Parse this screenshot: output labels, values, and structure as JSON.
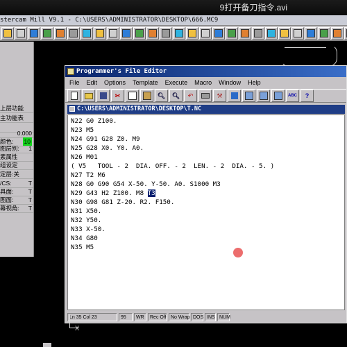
{
  "video": {
    "title": "9打开备刀指令.avi"
  },
  "mastercam": {
    "title": "stercam Mill V9.1 - C:\\USERS\\ADMINISTRATOR\\DESKTOP\\666.MC9",
    "toolbar_icons": [
      "prev-icon",
      "next-icon",
      "zoom-in-icon",
      "zoom-out-icon",
      "zoom-window-icon",
      "pan-icon",
      "fit-icon",
      "view-top-icon",
      "view-front-icon",
      "view-side-icon",
      "view-iso-icon",
      "cube-icon",
      "cube-top-icon",
      "cube-front-icon",
      "cube-side-icon",
      "cube-iso-icon",
      "cube-back-icon",
      "cube-bottom-icon",
      "cube-right-icon",
      "cube-left-icon",
      "cube-view-icon",
      "measure-icon",
      "palette-icon",
      "clipboard-icon",
      "settings-icon",
      "shade-icon",
      "help-icon",
      "globe-icon",
      "sum-icon",
      "chip-icon"
    ],
    "left_menu": [
      {
        "label": "上层功能",
        "value": ""
      },
      {
        "label": "主功能表",
        "value": ""
      },
      {
        "label": "",
        "value": ""
      },
      {
        "label": "",
        "value": "0.000"
      },
      {
        "label": "颜色:",
        "value": "10"
      },
      {
        "label": "图层别:",
        "value": "1"
      },
      {
        "label": "素属性",
        "value": ""
      },
      {
        "label": "组设定",
        "value": ""
      },
      {
        "label": "定层:关",
        "value": ""
      },
      {
        "label": "/CS:",
        "value": "T"
      },
      {
        "label": "具面:",
        "value": "T"
      },
      {
        "label": "图面:",
        "value": "T"
      },
      {
        "label": "幕视角:",
        "value": "T"
      }
    ],
    "axis_label": "X"
  },
  "pfe": {
    "title": "Programmer's File Editor",
    "menu": [
      "File",
      "Edit",
      "Options",
      "Template",
      "Execute",
      "Macro",
      "Window",
      "Help"
    ],
    "doc_title": "C:\\USERS\\ADMINISTRATOR\\DESKTOP\\T.NC",
    "lines": [
      "N22 G0 Z100.",
      "N23 M5",
      "N24 G91 G28 Z0. M9",
      "N25 G28 X0. Y0. A0.",
      "N26 M01",
      "( V5   TOOL - 2  DIA. OFF. - 2  LEN. - 2  DIA. - 5. )",
      "N27 T2 M6",
      "N28 G0 G90 G54 X-50. Y-50. A0. S1000 M3",
      "N29 G43 H2 Z100. M8 ",
      "N30 G98 G81 Z-20. R2. F150.",
      "N31 X50.",
      "N32 Y50.",
      "N33 X-50.",
      "N34 G80",
      "N35 M5"
    ],
    "selected_text": "T3",
    "status": [
      "Ln 35 Col 23",
      "95",
      "WR",
      "Rec Off",
      "No Wrap",
      "DOS",
      "INS",
      "NUM"
    ]
  },
  "colors": {
    "title_blue": "#0a246a",
    "doc_blue": "#1f3d86",
    "highlight_green": "#11d41a"
  }
}
